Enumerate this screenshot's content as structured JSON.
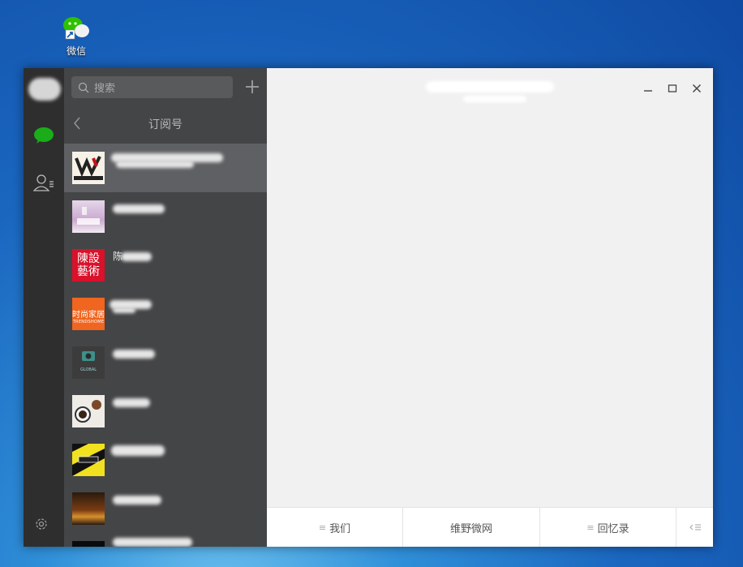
{
  "desktop": {
    "wechat_icon_label": "微信"
  },
  "sidebar": {},
  "list_panel": {
    "search_placeholder": "搜索",
    "add_symbol": "+",
    "title": "订阅号",
    "items": [
      {
        "name": "",
        "thumb": "w-logo"
      },
      {
        "name": "",
        "thumb": "pink-room"
      },
      {
        "name": "陈",
        "thumb": "red-seal",
        "seal_text": "陳設藝術"
      },
      {
        "name": "",
        "thumb": "trend-home",
        "brand_cn": "时尚家居",
        "brand_en": "TRENDSHOME"
      },
      {
        "name": "",
        "thumb": "camera",
        "brand_en": "GLOBAL"
      },
      {
        "name": "",
        "thumb": "coffee"
      },
      {
        "name": "",
        "thumb": "yellow-badge"
      },
      {
        "name": "",
        "thumb": "city-night"
      },
      {
        "name": "",
        "thumb": "dark"
      }
    ]
  },
  "chat": {
    "menu": [
      {
        "label": "我们",
        "has_icon": true
      },
      {
        "label": "维野微网",
        "has_icon": false
      },
      {
        "label": "回忆录",
        "has_icon": true
      }
    ]
  },
  "colors": {
    "accent_green": "#1aad19",
    "nav_bg": "#2e2e2e",
    "list_bg": "#444547"
  }
}
